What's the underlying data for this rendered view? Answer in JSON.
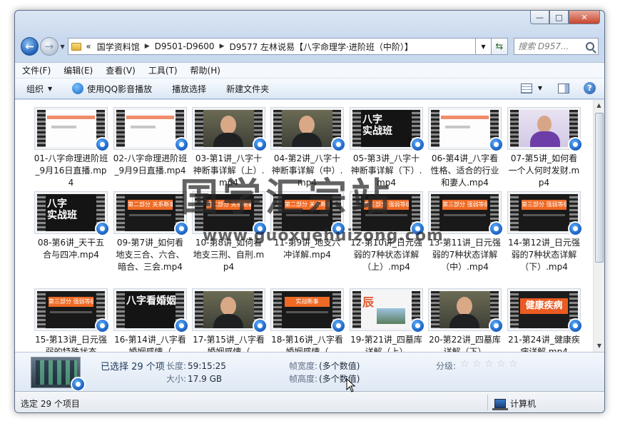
{
  "window": {
    "controls": {
      "minimize": "—",
      "maximize": "□",
      "close": "✕"
    }
  },
  "address": {
    "lead": "«",
    "crumbs": [
      "国学资料馆",
      "D9501-D9600",
      "D9577 左林说易【八字命理学·进阶班（中阶）】"
    ],
    "search_placeholder": "搜索 D957..."
  },
  "menu": [
    "文件(F)",
    "编辑(E)",
    "查看(V)",
    "工具(T)",
    "帮助(H)"
  ],
  "toolbar": {
    "organize": "组织",
    "play_qq": "使用QQ影音播放",
    "play_selection": "播放选择",
    "new_folder": "新建文件夹",
    "help": "?"
  },
  "files": [
    {
      "name": "01-八字命理进阶班_9月16日直播.mp4",
      "style": "ppt"
    },
    {
      "name": "02-八字命理进阶班_9月9日直播.mp4",
      "style": "ppt"
    },
    {
      "name": "03-第1讲_八字十神断事详解（上）.mp4",
      "style": "face"
    },
    {
      "name": "04-第2讲_八字十神断事详解（中）.mp4",
      "style": "face"
    },
    {
      "name": "05-第3讲_八字十神断事详解（下）.mp4",
      "style": "dark",
      "thumb_text": "八字\n实战班"
    },
    {
      "name": "06-第4讲_八字看性格、适合的行业和妻人.mp4",
      "style": "ppt"
    },
    {
      "name": "07-第5讲_如何看一个人何时发财.mp4",
      "style": "purple"
    },
    {
      "name": "08-第6讲_天干五合与四冲.mp4",
      "style": "dark",
      "thumb_text": "八字\n实战班"
    },
    {
      "name": "09-第7讲_如何看地支三合、六合、暗合、三会.mp4",
      "style": "orange",
      "thumb_text": "第二部分 关系断事"
    },
    {
      "name": "10-第8讲_如何看地支三刑、自刑.mp4",
      "style": "orange",
      "thumb_text": "第二部分 关系断事"
    },
    {
      "name": "11-第9讲_地支六冲详解.mp4",
      "style": "orange",
      "thumb_text": "第二部分 关系断事"
    },
    {
      "name": "12-第10讲_日元强弱的7种状态详解（上）.mp4",
      "style": "orange",
      "thumb_text": "第三部分 强弱等级"
    },
    {
      "name": "13-第11讲_日元强弱的7种状态详解（中）.mp4",
      "style": "orange",
      "thumb_text": "第三部分 强弱等级"
    },
    {
      "name": "14-第12讲_日元强弱的7种状态详解（下）.mp4",
      "style": "orange",
      "thumb_text": "第三部分 强弱等级"
    },
    {
      "name": "15-第13讲_日元强弱的特殊状态",
      "style": "orange",
      "thumb_text": "第三部分 强弱等级"
    },
    {
      "name": "16-第14讲_八字看婚姻感情（",
      "style": "dark",
      "thumb_text": "八字看婚姻感情"
    },
    {
      "name": "17-第15讲_八字看婚姻感情（",
      "style": "face"
    },
    {
      "name": "18-第16讲_八字看婚姻感情（",
      "style": "orange",
      "thumb_text": "实战断事"
    },
    {
      "name": "19-第21讲_四墓库详解（上）",
      "style": "map",
      "thumb_text": "辰"
    },
    {
      "name": "20-第22讲_四墓库详解（下）",
      "style": "face"
    },
    {
      "name": "21-第24讲_健康疾病详解.mp4",
      "style": "health",
      "thumb_text": "健康疾病"
    }
  ],
  "watermark": {
    "cn": "国学汇宗站",
    "url": "www.guoxuehuizong.com"
  },
  "details": {
    "selected": "已选择 29 个项",
    "length_label": "长度:",
    "length_value": "59:15:25",
    "size_label": "大小:",
    "size_value": "17.9 GB",
    "frame_width_label": "帧宽度:",
    "frame_width_value": "(多个数值)",
    "frame_height_label": "帧高度:",
    "frame_height_value": "(多个数值)",
    "rating_label": "分级:",
    "rating_stars": 0
  },
  "status": {
    "left": "选定 29 个项目",
    "right": "计算机"
  }
}
